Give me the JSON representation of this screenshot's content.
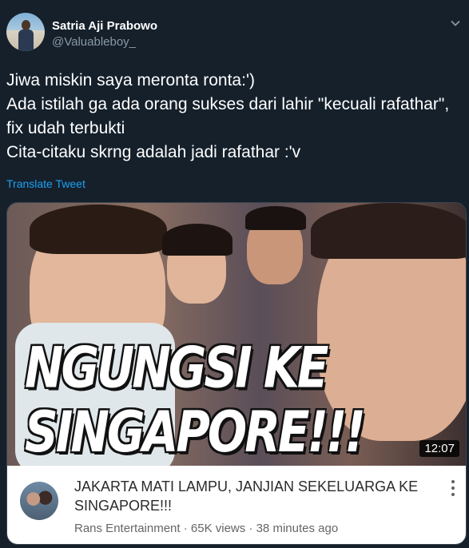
{
  "tweet": {
    "author_name": "Satria Aji Prabowo",
    "handle": "@Valuableboy_",
    "text": "Jiwa miskin saya meronta ronta:')\nAda istilah ga ada orang sukses dari lahir \"kecuali rafathar\", fix udah terbukti\nCita-citaku skrng adalah jadi rafathar :'v",
    "translate_label": "Translate Tweet"
  },
  "video_card": {
    "thumbnail_overlay": "NGUNGSI KE SINGAPORE!!!",
    "duration": "12:07",
    "title": "JAKARTA MATI LAMPU, JANJIAN SEKELUARGA KE SINGAPORE!!!",
    "subtitle": "Rans Entertainment · 65K views · 38 minutes ago"
  },
  "icons": {
    "chevron": "chevron-down-icon",
    "menu": "more-vertical-icon"
  },
  "colors": {
    "background": "#15202b",
    "link": "#1da1f2",
    "muted": "#8899a6"
  }
}
